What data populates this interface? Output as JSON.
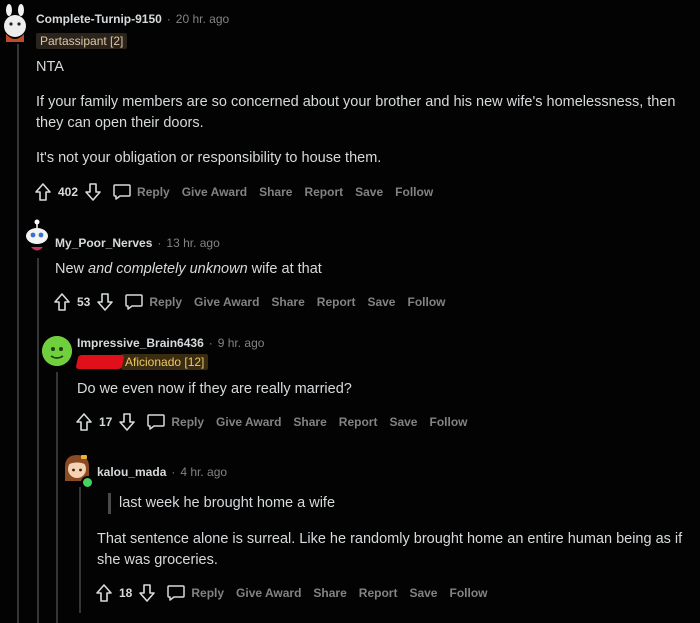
{
  "comments": [
    {
      "username": "Complete-Turnip-9150",
      "time": "20 hr. ago",
      "flair": "Partassipant [2]",
      "paragraphs": [
        "NTA",
        "If your family members are so concerned about your brother and his new wife's homelessness, then they can open their doors.",
        "It's not your obligation or responsibility to house them."
      ],
      "votes": "402"
    },
    {
      "username": "My_Poor_Nerves",
      "time": "13 hr. ago",
      "text_before": "New ",
      "text_em": "and completely unknown",
      "text_after": " wife at that",
      "votes": "53"
    },
    {
      "username": "Impressive_Brain6436",
      "time": "9 hr. ago",
      "flair": "Aficionado [12]",
      "paragraphs": [
        "Do we even now if they are really married?"
      ],
      "votes": "17"
    },
    {
      "username": "kalou_mada",
      "time": "4 hr. ago",
      "quote": "last week he brought home a wife",
      "paragraphs": [
        "That sentence alone is surreal. Like he randomly brought home an entire human being as if she was groceries."
      ],
      "votes": "18"
    }
  ],
  "actions": {
    "reply": "Reply",
    "give_award": "Give Award",
    "share": "Share",
    "report": "Report",
    "save": "Save",
    "follow": "Follow"
  },
  "separator": "·",
  "colors": {
    "background": "#030303",
    "text": "#d7dadc",
    "meta": "#818384",
    "online": "#46d160"
  }
}
